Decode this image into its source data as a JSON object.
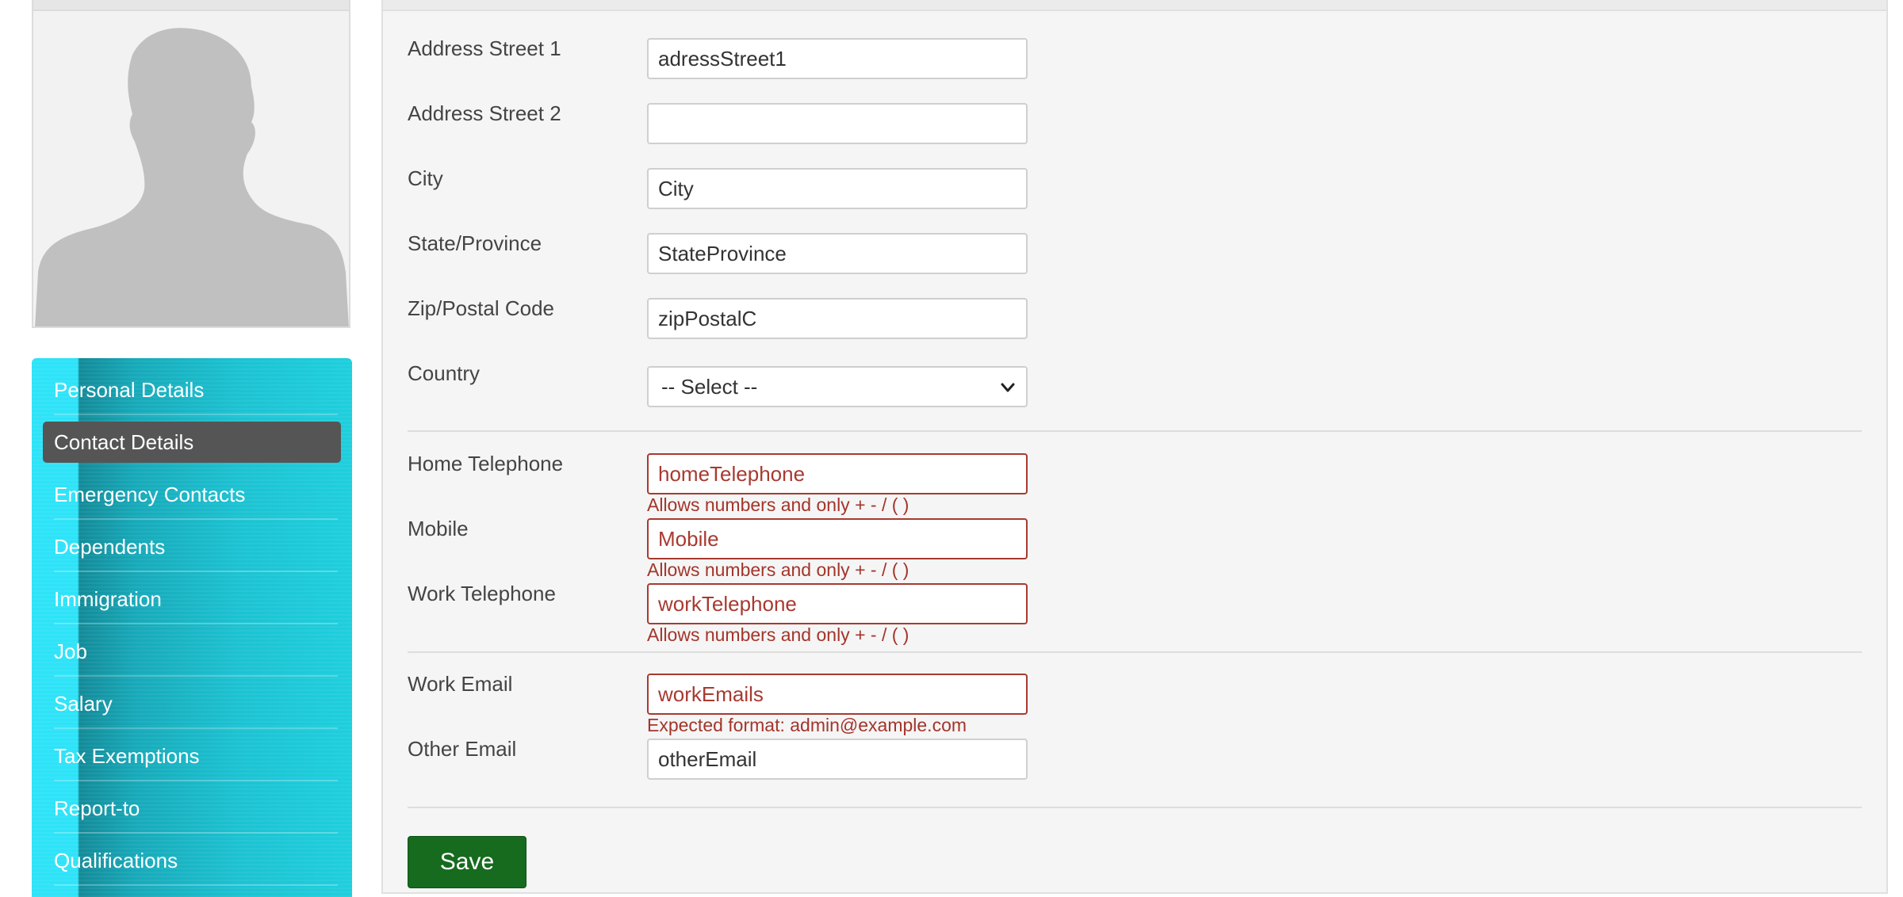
{
  "sidebar": {
    "items": [
      {
        "label": "Personal Details"
      },
      {
        "label": "Contact Details"
      },
      {
        "label": "Emergency Contacts"
      },
      {
        "label": "Dependents"
      },
      {
        "label": "Immigration"
      },
      {
        "label": "Job"
      },
      {
        "label": "Salary"
      },
      {
        "label": "Tax Exemptions"
      },
      {
        "label": "Report-to"
      },
      {
        "label": "Qualifications"
      }
    ],
    "active_item": "Contact Details"
  },
  "form": {
    "address_street_1": {
      "label": "Address Street 1",
      "value": "adressStreet1"
    },
    "address_street_2": {
      "label": "Address Street 2",
      "value": ""
    },
    "city": {
      "label": "City",
      "value": "City"
    },
    "state_province": {
      "label": "State/Province",
      "value": "StateProvince"
    },
    "zip_postal_code": {
      "label": "Zip/Postal Code",
      "value": "zipPostalC"
    },
    "country": {
      "label": "Country",
      "selected": "-- Select --"
    },
    "home_telephone": {
      "label": "Home Telephone",
      "value": "homeTelephone",
      "error": "Allows numbers and only + - / ( )"
    },
    "mobile": {
      "label": "Mobile",
      "value": "Mobile",
      "error": "Allows numbers and only + - / ( )"
    },
    "work_telephone": {
      "label": "Work Telephone",
      "value": "workTelephone",
      "error": "Allows numbers and only + - / ( )"
    },
    "work_email": {
      "label": "Work Email",
      "value": "workEmails",
      "error": "Expected format: admin@example.com"
    },
    "other_email": {
      "label": "Other Email",
      "value": "otherEmail"
    },
    "save_label": "Save"
  },
  "colors": {
    "error": "#a3352b",
    "save_button": "#166b1e",
    "active_nav": "#555555",
    "sidebar_accent": "#2ee3f8"
  }
}
